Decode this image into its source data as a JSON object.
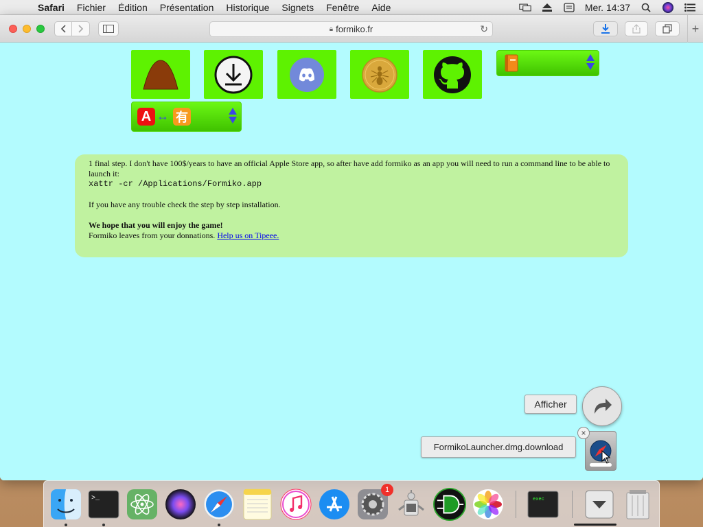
{
  "menubar": {
    "app_name": "Safari",
    "items": [
      "Fichier",
      "Édition",
      "Présentation",
      "Historique",
      "Signets",
      "Fenêtre",
      "Aide"
    ],
    "clock": "Mer. 14:37"
  },
  "browser": {
    "url": "formiko.fr"
  },
  "page": {
    "tiles": [
      {
        "name": "anthill-tile",
        "icon": "anthill-icon"
      },
      {
        "name": "download-tile",
        "icon": "download-icon"
      },
      {
        "name": "discord-tile",
        "icon": "discord-icon"
      },
      {
        "name": "tipeee-coin-tile",
        "icon": "ant-coin-icon"
      },
      {
        "name": "github-tile",
        "icon": "github-icon"
      }
    ],
    "guide_select_icon": "book-icon",
    "language_select_icons": {
      "left": "A",
      "arrow": "↔",
      "right": "有"
    },
    "info": {
      "line1": "1 final step. I don't have 100$/years to have an official Apple Store app, so after have add formiko as an app you will need to run a command line to be able to launch it:",
      "command": "xattr -cr /Applications/Formiko.app",
      "trouble": "If you have any trouble check the step by step installation.",
      "enjoy": "We hope that you will enjoy the game!",
      "donation_text": "Formiko leaves from your donnations.",
      "donation_link": "Help us on Tipeee."
    }
  },
  "download_popover": {
    "reveal_button": "Afficher",
    "file_name": "FormikoLauncher.dmg.download"
  },
  "dock": {
    "apps": [
      "Finder",
      "Terminal",
      "Atom",
      "Siri",
      "Safari",
      "Notes",
      "iTunes",
      "App Store",
      "Préférences Système",
      "Automator",
      "Logisim",
      "Photos"
    ],
    "system_prefs_badge": "1",
    "exec_label": "exec"
  },
  "colors": {
    "page_bg": "#b3fbfe",
    "tile_green": "#5ef201",
    "info_bg": "#c0f2a0",
    "link": "#0000ee"
  }
}
